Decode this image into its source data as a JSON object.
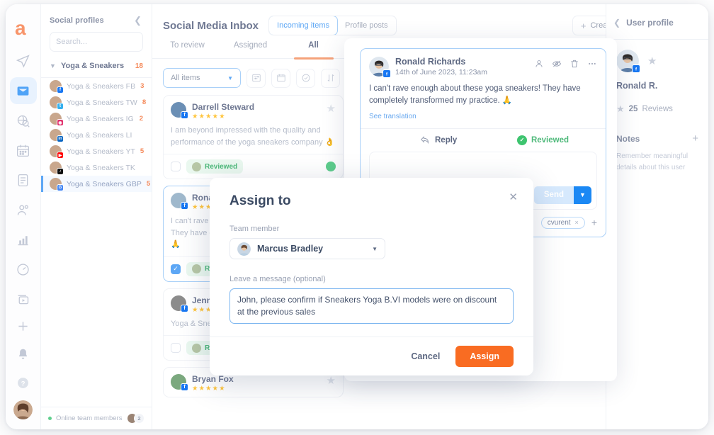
{
  "brand": {
    "logo_letter": "a",
    "accent": "#f58a5b",
    "blue": "#5da7f5"
  },
  "rail": {
    "items": [
      {
        "name": "send-icon",
        "label": "Publishing"
      },
      {
        "name": "inbox-icon",
        "label": "Inbox",
        "active": true
      },
      {
        "name": "globe-search-icon",
        "label": "Listening"
      },
      {
        "name": "calendar-icon",
        "label": "Calendar"
      },
      {
        "name": "report-icon",
        "label": "Reports"
      },
      {
        "name": "people-icon",
        "label": "Audience"
      },
      {
        "name": "analytics-icon",
        "label": "Analytics"
      },
      {
        "name": "speedometer-icon",
        "label": "Benchmarks"
      },
      {
        "name": "ads-icon",
        "label": "Ads"
      }
    ],
    "bottom": [
      {
        "name": "plus-icon",
        "label": "Add"
      },
      {
        "name": "bell-icon",
        "label": "Notifications"
      },
      {
        "name": "help-icon",
        "label": "Help"
      }
    ]
  },
  "sidebar": {
    "title": "Social profiles",
    "collapse_icon": "chevron-left-icon",
    "search": {
      "placeholder": "Search...",
      "value": "",
      "icon": "search-icon"
    },
    "group": {
      "caret": "chevron-down-icon",
      "name": "Yoga & Sneakers",
      "count": "18"
    },
    "profiles": [
      {
        "name": "Yoga & Sneakers FB",
        "count": "3",
        "network": "facebook",
        "color": "#1877f2",
        "glyph": "f"
      },
      {
        "name": "Yoga & Sneakers TW",
        "count": "8",
        "network": "twitter",
        "color": "#35b0ee",
        "glyph": "t"
      },
      {
        "name": "Yoga & Sneakers IG",
        "count": "2",
        "network": "instagram",
        "color": "#e1306c",
        "glyph": "◉"
      },
      {
        "name": "Yoga & Sneakers LI",
        "count": "",
        "network": "linkedin",
        "color": "#0a66c2",
        "glyph": "in"
      },
      {
        "name": "Yoga & Sneakers YT",
        "count": "5",
        "network": "youtube",
        "color": "#ff0000",
        "glyph": "▶"
      },
      {
        "name": "Yoga & Sneakers TK",
        "count": "",
        "network": "tiktok",
        "color": "#111111",
        "glyph": "♪"
      },
      {
        "name": "Yoga & Sneakers GBP",
        "count": "5",
        "network": "google-business",
        "color": "#4285f4",
        "glyph": "G",
        "selected": true
      }
    ],
    "footer": {
      "status": "Online team members",
      "count": "2"
    }
  },
  "header": {
    "page_title": "Social Media Inbox",
    "segments": [
      {
        "label": "Incoming items",
        "active": true
      },
      {
        "label": "Profile posts",
        "active": false
      }
    ],
    "moderation_button": {
      "label": "Create moderation rule",
      "icon": "plus-icon"
    },
    "settings_icon": "gear-icon"
  },
  "tabs": [
    {
      "label": "To review",
      "active": false
    },
    {
      "label": "Assigned",
      "active": false
    },
    {
      "label": "All",
      "active": true
    }
  ],
  "filters": {
    "select_label": "All items",
    "caret": "chevron-down-icon",
    "buttons": [
      {
        "name": "filter-icon"
      },
      {
        "name": "calendar-icon"
      },
      {
        "name": "check-circle-icon"
      },
      {
        "name": "sort-icon"
      }
    ]
  },
  "list": [
    {
      "author": "Darrell Steward",
      "rating": 5,
      "stars": "★★★★★",
      "text": "I am beyond impressed with the quality and performance of the yoga sneakers company 👌",
      "checked": false,
      "status": "Reviewed",
      "network": "facebook",
      "avatar_color": "#6b8fb5",
      "badge_color": "#1877f2",
      "badge_glyph": "f",
      "starred": false
    },
    {
      "author": "Ronald Richards",
      "rating": 5,
      "stars": "★★★★★",
      "text": "I can't rave enough about these yoga sneakers! They have completely transformed my practice. 🙏",
      "checked": true,
      "status": "Reviewed",
      "network": "facebook",
      "avatar_color": "#9fb8cc",
      "badge_color": "#1877f2",
      "badge_glyph": "f",
      "selected": true,
      "starred": false
    },
    {
      "author": "Jenny Wilson",
      "rating": 3,
      "stars": "★★★",
      "text": "Yoga & Sneakers are the best for me! ❤️",
      "checked": false,
      "status": "Reviewed",
      "network": "facebook",
      "avatar_color": "#8c8c8c",
      "badge_color": "#1877f2",
      "badge_glyph": "f",
      "starred": false
    },
    {
      "author": "Bryan Fox",
      "rating": 5,
      "stars": "★★★★★",
      "text": "",
      "checked": false,
      "status": "",
      "network": "facebook",
      "avatar_color": "#7ba87e",
      "badge_color": "#1877f2",
      "badge_glyph": "f",
      "starred": false
    }
  ],
  "conversation": {
    "author": "Ronald Richards",
    "timestamp": "14th of June 2023, 11:23am",
    "message": "I can't rave enough about these yoga sneakers! They have completely transformed my practice. 🙏",
    "see_translation": "See translation",
    "actions": [
      {
        "name": "user-icon"
      },
      {
        "name": "hide-eye-icon"
      },
      {
        "name": "trash-icon"
      },
      {
        "name": "more-horizontal-icon"
      }
    ],
    "reply_label": "Reply",
    "reply_icon": "reply-icon",
    "reviewed_label": "Reviewed",
    "reviewed_icon": "check-circle-icon",
    "reply_placeholder": "",
    "send_label": "Send",
    "send_caret": "chevron-down-icon",
    "tag": {
      "label": "cvurent",
      "remove": "×"
    },
    "add_tag": "+"
  },
  "user_profile": {
    "back_icon": "chevron-left-icon",
    "title": "User profile",
    "star_icon": "star-icon",
    "name": "Ronald R.",
    "reviews_count": "25",
    "reviews_label": "Reviews",
    "notes_title": "Notes",
    "notes_add": "+",
    "notes_hint": "Remember meaningful details about this user"
  },
  "modal": {
    "title": "Assign to",
    "close_icon": "close-icon",
    "team_member_label": "Team member",
    "team_member_value": "Marcus Bradley",
    "team_member_caret": "chevron-down-icon",
    "message_label": "Leave a message (optional)",
    "message_value": "John, please confirm if Sneakers Yoga B.VI models were on discount at the previous sales",
    "cancel_label": "Cancel",
    "assign_label": "Assign",
    "assign_color": "#f96c22"
  }
}
